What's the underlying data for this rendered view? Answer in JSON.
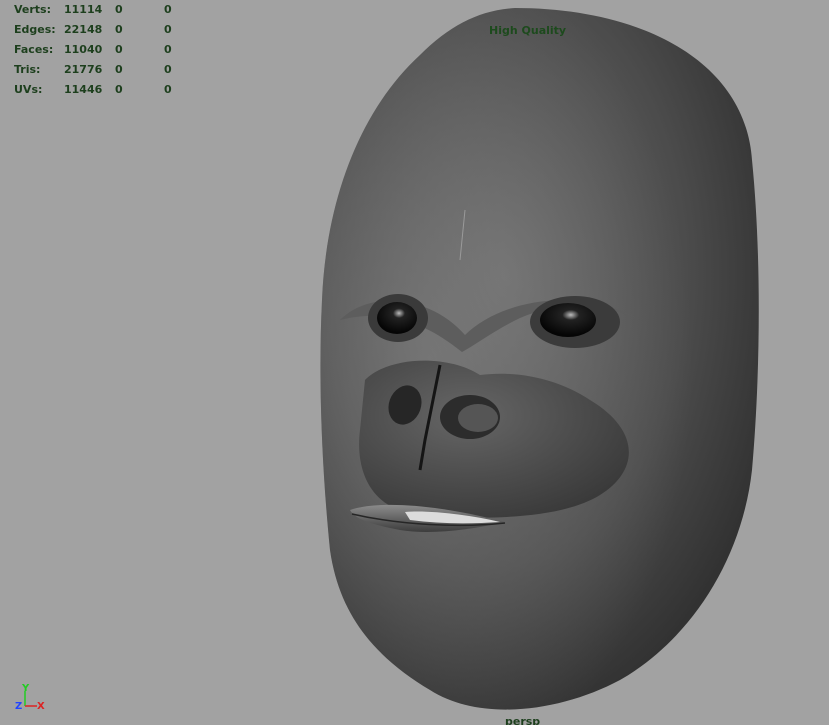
{
  "hud": {
    "rows": [
      {
        "label": "Verts:",
        "v1": "11114",
        "v2": "0",
        "v3": "0"
      },
      {
        "label": "Edges:",
        "v1": "22148",
        "v2": "0",
        "v3": "0"
      },
      {
        "label": "Faces:",
        "v1": "11040",
        "v2": "0",
        "v3": "0"
      },
      {
        "label": "Tris:",
        "v1": "21776",
        "v2": "0",
        "v3": "0"
      },
      {
        "label": "UVs:",
        "v1": "11446",
        "v2": "0",
        "v3": "0"
      }
    ]
  },
  "viewport": {
    "quality_label": "High Quality",
    "camera_name": "persp",
    "background_color": "#a2a2a2",
    "hud_text_color": "#1d3f1d"
  },
  "axis": {
    "y": "Y",
    "z": "Z",
    "x": "X",
    "y_color": "#22cc22",
    "z_color": "#2244ff",
    "x_color": "#dd2222"
  }
}
